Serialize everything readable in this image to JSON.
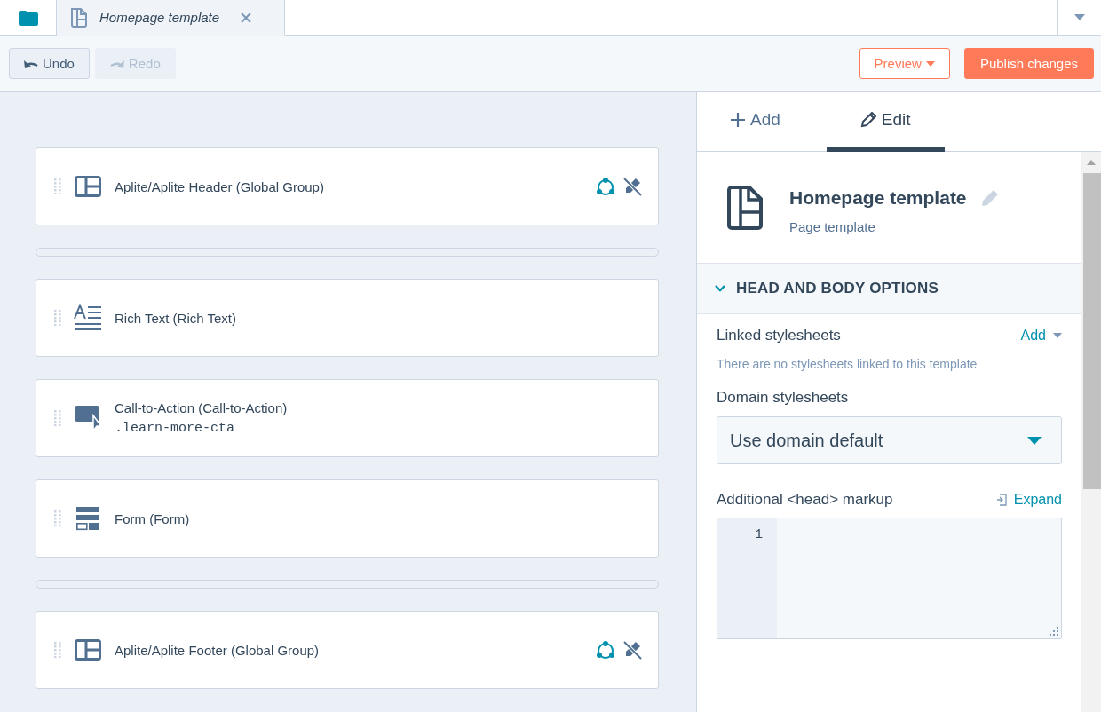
{
  "file_tabs": [
    {
      "kind": "folder",
      "selected": false
    },
    {
      "kind": "file",
      "label": "Homepage template",
      "selected": true
    }
  ],
  "toolbar": {
    "undo": {
      "label": "Undo",
      "disabled": false
    },
    "redo": {
      "label": "Redo",
      "disabled": true
    },
    "preview": {
      "label": "Preview"
    },
    "publish": {
      "label": "Publish changes"
    }
  },
  "modules": [
    {
      "kind": "global-group",
      "label": "Aplite/Aplite Header (Global Group)"
    },
    {
      "kind": "drop-zone"
    },
    {
      "kind": "rich-text",
      "label": "Rich Text (Rich Text)"
    },
    {
      "kind": "cta",
      "label": "Call-to-Action (Call-to-Action)",
      "class_name": ".learn-more-cta"
    },
    {
      "kind": "form",
      "label": "Form (Form)"
    },
    {
      "kind": "drop-zone"
    },
    {
      "kind": "global-group",
      "label": "Aplite/Aplite Footer (Global Group)"
    }
  ],
  "panel": {
    "tabs": [
      {
        "kind": "add",
        "label": "Add",
        "selected": false
      },
      {
        "kind": "edit",
        "label": "Edit",
        "selected": true
      }
    ],
    "template": {
      "title": "Homepage template",
      "subtitle": "Page template"
    },
    "section": {
      "title": "HEAD AND BODY OPTIONS",
      "expanded": true
    },
    "linked_stylesheets": {
      "label": "Linked stylesheets",
      "action": "Add",
      "empty_text": "There are no stylesheets linked to this template"
    },
    "domain_stylesheets": {
      "label": "Domain stylesheets",
      "value": "Use domain default"
    },
    "head_markup": {
      "label": "Additional <head> markup",
      "action": "Expand",
      "line_numbers": [
        "1"
      ]
    }
  }
}
